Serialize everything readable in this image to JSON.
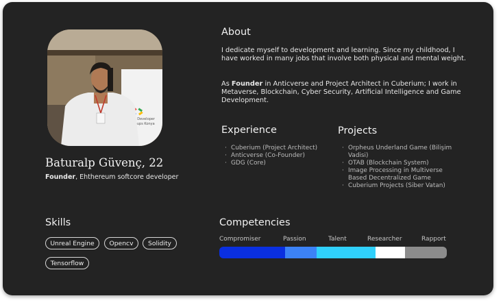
{
  "profile": {
    "name": "Baturalp Güvenç, 22",
    "role_bold": "Founder",
    "role_rest": ", Ehthereum softcore developer",
    "photo_banner_text": "Google Developer Groups Konya"
  },
  "about": {
    "title": "About",
    "paragraph1": "I dedicate myself to development and learning. Since my childhood, I have worked in many jobs that involve both physical and mental weight.",
    "paragraph2_prefix": "As ",
    "paragraph2_bold": "Founder",
    "paragraph2_rest": " in Anticverse and Project Architect in Cuberium; I work in Metaverse, Blockchain, Cyber Security, Artificial Intelligence and Game Development."
  },
  "experience": {
    "title": "Experience",
    "items": [
      "Cuberium (Project Architect)",
      "Anticverse (Co-Founder)",
      "GDG (Core)"
    ]
  },
  "projects": {
    "title": "Projects",
    "items": [
      "Orpheus Underland Game (Bilişim Vadisi)",
      "OTAB (Blockchain System)",
      "Image Processing in Multiverse Based Decentralized Game",
      "Cuberium Projects (Siber Vatan)"
    ]
  },
  "skills": {
    "title": "Skills",
    "items": [
      "Unreal Engine",
      "Opencv",
      "Solidity",
      "Tensorflow"
    ]
  },
  "competencies": {
    "title": "Competencies",
    "items": [
      {
        "label": "Compromiser",
        "share": 0.29,
        "color": "#0a2fe0"
      },
      {
        "label": "Passion",
        "share": 0.14,
        "color": "#3c82f6"
      },
      {
        "label": "Talent",
        "share": 0.26,
        "color": "#30d0fb"
      },
      {
        "label": "Researcher",
        "share": 0.13,
        "color": "#ffffff"
      },
      {
        "label": "Rapport",
        "share": 0.18,
        "color": "#8c8c8c"
      }
    ]
  }
}
